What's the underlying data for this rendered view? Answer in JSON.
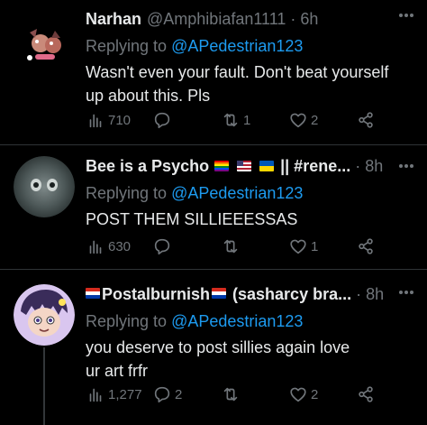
{
  "tweets": [
    {
      "name": "Narhan",
      "handle": "@Amphibiafan1111",
      "dot": "·",
      "time": "6h",
      "reply_prefix": "Replying to ",
      "reply_to": "@APedestrian123",
      "text": "Wasn't even your fault. Don't beat yourself up about this. Pls",
      "views": "710",
      "replies": "",
      "retweets": "1",
      "likes": "2"
    },
    {
      "name": "Bee is a Psycho",
      "name_suffix": "|| #rene...",
      "dot": "·",
      "time": "8h",
      "reply_prefix": "Replying to ",
      "reply_to": "@APedestrian123",
      "text": "POST THEM SILLIEEESSAS",
      "views": "630",
      "replies": "",
      "retweets": "",
      "likes": "1"
    },
    {
      "name": "Postalburnish",
      "name_suffix": "(sasharcy bra...",
      "dot": "·",
      "time": "8h",
      "reply_prefix": "Replying to ",
      "reply_to": "@APedestrian123",
      "text": "you deserve to post sillies again love ur art frfr",
      "views": "1,277",
      "replies": "2",
      "retweets": "",
      "likes": "2"
    }
  ],
  "icons": {
    "views": "bar-chart-icon",
    "reply": "speech-bubble-icon",
    "retweet": "retweet-icon",
    "like": "heart-icon",
    "share": "share-icon"
  },
  "colors": {
    "background": "#000000",
    "text": "#e7e9ea",
    "muted": "#71767b",
    "link": "#1d9bf0",
    "divider": "#2f3336"
  }
}
